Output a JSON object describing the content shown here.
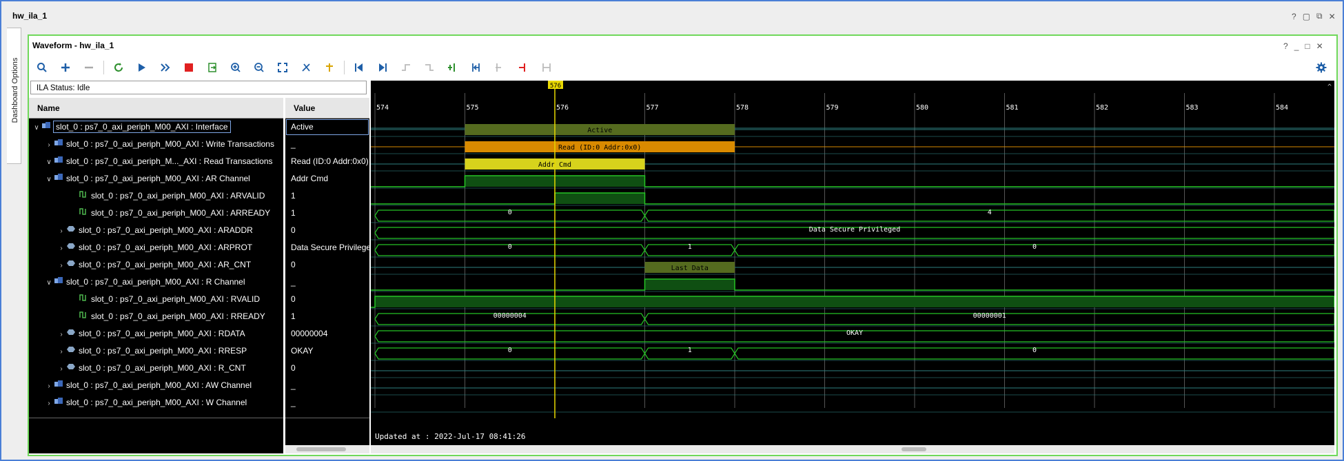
{
  "window": {
    "title": "hw_ila_1"
  },
  "side_tab": {
    "label": "Dashboard Options"
  },
  "waveform": {
    "title": "Waveform - hw_ila_1",
    "ila_status": "ILA Status:  Idle",
    "columns": {
      "name": "Name",
      "value": "Value"
    },
    "cursor_label": "576",
    "updated_at": "Updated at : 2022-Jul-17 08:41:26",
    "ticks": [
      "574",
      "575",
      "576",
      "577",
      "578",
      "579",
      "580",
      "581",
      "582",
      "583",
      "584"
    ]
  },
  "toolbar_icons": [
    "search-icon",
    "add-icon",
    "remove-icon",
    "refresh-icon",
    "run-trigger-icon",
    "run-immediate-icon",
    "stop-icon",
    "export-icon",
    "zoom-in-icon",
    "zoom-out-icon",
    "zoom-fit-icon",
    "cursor-icon",
    "marker-icon",
    "go-to-start-icon",
    "go-to-end-icon",
    "prev-transition-icon",
    "next-transition-icon",
    "add-marker-icon",
    "prev-marker-icon",
    "next-marker-icon",
    "swap-cursor-icon",
    "expand-icon"
  ],
  "signals": [
    {
      "name": "slot_0 : ps7_0_axi_periph_M00_AXI : Interface",
      "value": "Active",
      "level": 0,
      "expander": "open",
      "icon": "bus"
    },
    {
      "name": "slot_0 : ps7_0_axi_periph_M00_AXI : Write Transactions",
      "value": "_",
      "level": 1,
      "expander": "closed",
      "icon": "bus"
    },
    {
      "name": "slot_0 : ps7_0_axi_periph_M..._AXI : Read Transactions",
      "value": "Read (ID:0 Addr:0x0)",
      "level": 1,
      "expander": "open",
      "icon": "bus"
    },
    {
      "name": "slot_0 : ps7_0_axi_periph_M00_AXI : AR Channel",
      "value": "Addr Cmd",
      "level": 1,
      "expander": "open",
      "icon": "bus"
    },
    {
      "name": "slot_0 : ps7_0_axi_periph_M00_AXI : ARVALID",
      "value": "1",
      "level": 3,
      "expander": "",
      "icon": "bit"
    },
    {
      "name": "slot_0 : ps7_0_axi_periph_M00_AXI : ARREADY",
      "value": "1",
      "level": 3,
      "expander": "",
      "icon": "bit"
    },
    {
      "name": "slot_0 : ps7_0_axi_periph_M00_AXI : ARADDR",
      "value": "0",
      "level": 2,
      "expander": "closed",
      "icon": "vec"
    },
    {
      "name": "slot_0 : ps7_0_axi_periph_M00_AXI : ARPROT",
      "value": "Data Secure Privileged",
      "level": 2,
      "expander": "closed",
      "icon": "vec"
    },
    {
      "name": "slot_0 : ps7_0_axi_periph_M00_AXI : AR_CNT",
      "value": "0",
      "level": 2,
      "expander": "closed",
      "icon": "vec"
    },
    {
      "name": "slot_0 : ps7_0_axi_periph_M00_AXI : R Channel",
      "value": "_",
      "level": 1,
      "expander": "open",
      "icon": "bus"
    },
    {
      "name": "slot_0 : ps7_0_axi_periph_M00_AXI : RVALID",
      "value": "0",
      "level": 3,
      "expander": "",
      "icon": "bit"
    },
    {
      "name": "slot_0 : ps7_0_axi_periph_M00_AXI : RREADY",
      "value": "1",
      "level": 3,
      "expander": "",
      "icon": "bit"
    },
    {
      "name": "slot_0 : ps7_0_axi_periph_M00_AXI : RDATA",
      "value": "00000004",
      "level": 2,
      "expander": "closed",
      "icon": "vec"
    },
    {
      "name": "slot_0 : ps7_0_axi_periph_M00_AXI : RRESP",
      "value": "OKAY",
      "level": 2,
      "expander": "closed",
      "icon": "vec"
    },
    {
      "name": "slot_0 : ps7_0_axi_periph_M00_AXI : R_CNT",
      "value": "0",
      "level": 2,
      "expander": "closed",
      "icon": "vec"
    },
    {
      "name": "slot_0 : ps7_0_axi_periph_M00_AXI : AW Channel",
      "value": "_",
      "level": 1,
      "expander": "closed",
      "icon": "bus"
    },
    {
      "name": "slot_0 : ps7_0_axi_periph_M00_AXI : W Channel",
      "value": "_",
      "level": 1,
      "expander": "closed",
      "icon": "bus"
    }
  ],
  "waves": [
    {
      "type": "bus",
      "color": "#556b1f",
      "segments": [
        [
          575,
          578,
          "Active"
        ]
      ]
    },
    {
      "type": "bus",
      "color": "#d98a00",
      "segments": [
        [
          575,
          578,
          "Read (ID:0 Addr:0x0)"
        ]
      ]
    },
    {
      "type": "bus",
      "color": "#d7d21c",
      "segments": [
        [
          575,
          577,
          "Addr Cmd"
        ]
      ]
    },
    {
      "type": "bit",
      "high": [
        [
          575,
          577
        ]
      ]
    },
    {
      "type": "bit",
      "high": [
        [
          576,
          577
        ]
      ]
    },
    {
      "type": "vec",
      "segments": [
        [
          574,
          577,
          "0"
        ],
        [
          577,
          585,
          "4"
        ]
      ]
    },
    {
      "type": "vec",
      "segments": [
        [
          574,
          585,
          "Data Secure Privileged"
        ]
      ]
    },
    {
      "type": "vec",
      "segments": [
        [
          574,
          577,
          "0"
        ],
        [
          577,
          578,
          "1"
        ],
        [
          578,
          585,
          "0"
        ]
      ]
    },
    {
      "type": "bus",
      "color": "#556b1f",
      "segments": [
        [
          577,
          578,
          "Last Data"
        ]
      ]
    },
    {
      "type": "bit",
      "high": [
        [
          577,
          578
        ]
      ]
    },
    {
      "type": "bit",
      "high": [
        [
          574,
          585
        ]
      ]
    },
    {
      "type": "vec",
      "segments": [
        [
          574,
          577,
          "00000004"
        ],
        [
          577,
          585,
          "00000001"
        ]
      ]
    },
    {
      "type": "vec",
      "segments": [
        [
          574,
          585,
          "OKAY"
        ]
      ]
    },
    {
      "type": "vec",
      "segments": [
        [
          574,
          577,
          "0"
        ],
        [
          577,
          578,
          "1"
        ],
        [
          578,
          585,
          "0"
        ]
      ]
    },
    {
      "type": "empty"
    },
    {
      "type": "empty"
    }
  ],
  "colors": {
    "accent_green": "#6fd85a",
    "cursor": "#e8d800",
    "bit_fill": "#0f4f12",
    "line_green": "#25c425"
  }
}
